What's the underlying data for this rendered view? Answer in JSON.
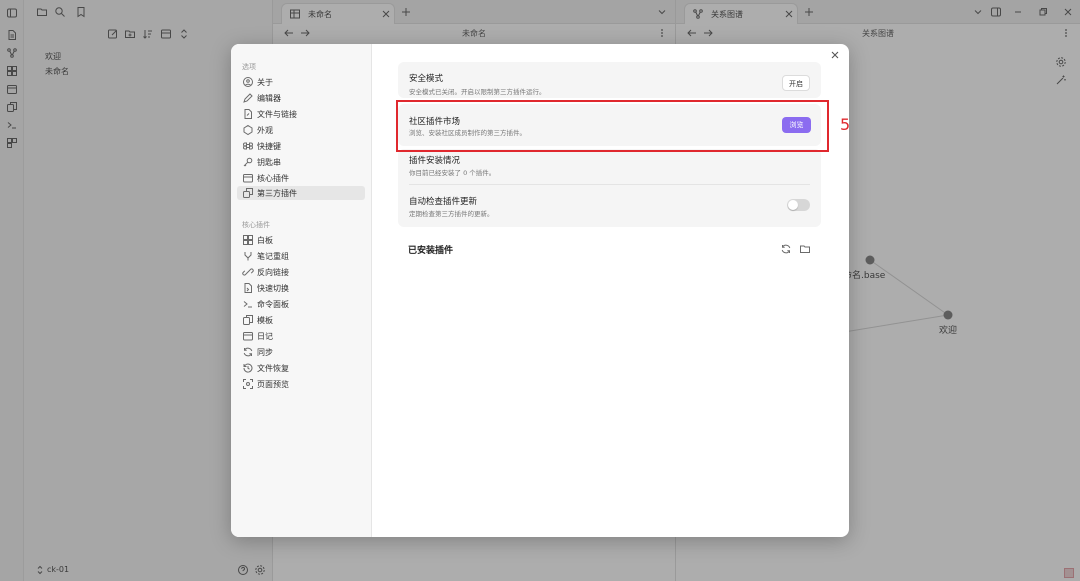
{
  "explorer": {
    "items": [
      "欢迎",
      "未命名"
    ],
    "vault_name": "ck-01"
  },
  "center": {
    "tab_title": "未命名",
    "nav_title": "未命名"
  },
  "right": {
    "tab_title": "关系图谱",
    "nav_title": "关系图谱",
    "graph_nodes": [
      {
        "label": "未命名.base"
      },
      {
        "label": "欢迎"
      }
    ]
  },
  "settings": {
    "options_heading": "选项",
    "options": [
      {
        "label": "关于",
        "icon": "info-icon"
      },
      {
        "label": "编辑器",
        "icon": "pencil-icon"
      },
      {
        "label": "文件与链接",
        "icon": "file-link-icon"
      },
      {
        "label": "外观",
        "icon": "palette-icon"
      },
      {
        "label": "快捷键",
        "icon": "command-icon"
      },
      {
        "label": "钥匙串",
        "icon": "key-icon"
      },
      {
        "label": "核心插件",
        "icon": "calendar-icon"
      },
      {
        "label": "第三方插件",
        "icon": "plugin-icon",
        "active": true
      }
    ],
    "core_heading": "核心插件",
    "core_plugins": [
      {
        "label": "白板",
        "icon": "canvas-icon"
      },
      {
        "label": "笔记重组",
        "icon": "merge-icon"
      },
      {
        "label": "反向链接",
        "icon": "backlink-icon"
      },
      {
        "label": "快速切换",
        "icon": "switcher-icon"
      },
      {
        "label": "命令面板",
        "icon": "terminal-icon"
      },
      {
        "label": "模板",
        "icon": "template-icon"
      },
      {
        "label": "日记",
        "icon": "calendar-icon"
      },
      {
        "label": "同步",
        "icon": "sync-icon"
      },
      {
        "label": "文件恢复",
        "icon": "history-icon"
      },
      {
        "label": "页面预览",
        "icon": "preview-icon"
      }
    ],
    "content": {
      "safe_mode_title": "安全模式",
      "safe_mode_desc": "安全模式已关闭。开启以限制第三方插件运行。",
      "safe_mode_button": "开启",
      "market_title": "社区插件市场",
      "market_desc": "浏览、安装社区成员制作的第三方插件。",
      "market_button": "浏览",
      "install_title": "插件安装情况",
      "install_desc": "你目前已经安装了 0 个插件。",
      "autocheck_title": "自动检查插件更新",
      "autocheck_desc": "定期检查第三方插件的更新。",
      "autocheck_enabled": false,
      "installed_heading": "已安装插件"
    }
  },
  "annotation": {
    "step_number": "5",
    "color": "#e0282e"
  },
  "colors": {
    "accent": "#8b6cf0"
  }
}
